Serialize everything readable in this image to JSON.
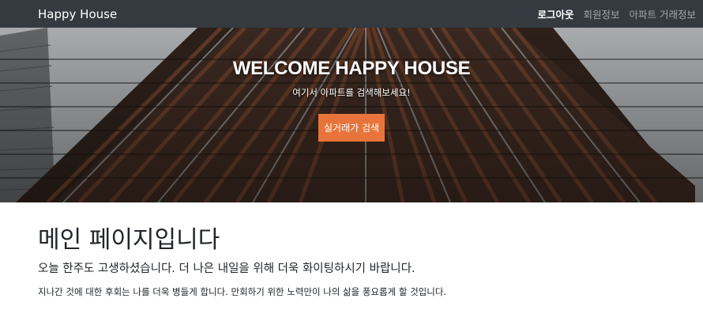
{
  "navbar": {
    "brand": "Happy House",
    "links": [
      {
        "label": "로그아웃",
        "active": true
      },
      {
        "label": "회원정보",
        "active": false
      },
      {
        "label": "아파트 거래정보",
        "active": false
      }
    ]
  },
  "hero": {
    "title": "WELCOME HAPPY HOUSE",
    "subtitle": "여기서 아파트를 검색해보세요!",
    "button_label": "실거래가 검색",
    "button_color": "#e8743b"
  },
  "main": {
    "title": "메인 페이지입니다",
    "lead": "오늘 한주도 고생하셨습니다. 더 나은 내일을 위해 더욱 화이팅하시기 바랍니다.",
    "text": "지나간 것에 대한 후회는 나를 더욱 병들게 합니다. 만회하기 위한 노력만이 나의 삶을 풍요롭게 할 것입니다."
  }
}
